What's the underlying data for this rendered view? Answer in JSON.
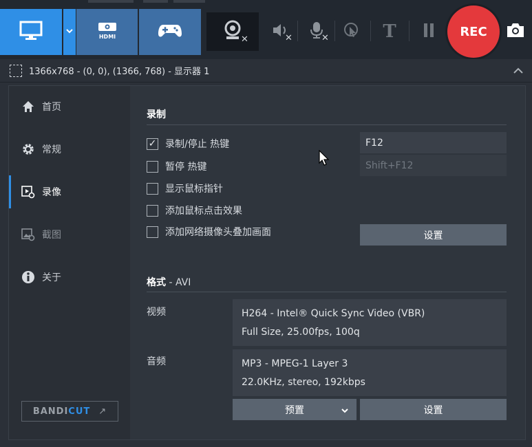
{
  "toolbar": {
    "modes": [
      {
        "name": "screen",
        "icon": "monitor-icon",
        "active": true
      },
      {
        "name": "hdmi",
        "icon": "hdmi-icon",
        "label": "HDMI"
      },
      {
        "name": "game",
        "icon": "gamepad-icon"
      }
    ],
    "tools": [
      {
        "name": "webcam",
        "icon": "webcam-icon"
      },
      {
        "name": "speaker",
        "icon": "speaker-icon"
      },
      {
        "name": "microphone",
        "icon": "microphone-icon"
      },
      {
        "name": "mouse-click",
        "icon": "click-icon"
      },
      {
        "name": "text",
        "icon": "text-icon",
        "label": "T"
      },
      {
        "name": "pause",
        "icon": "pause-icon"
      }
    ],
    "rec_label": "REC",
    "camera": "camera-icon",
    "accent_color": "#2f8fe6",
    "rec_color": "#e4393c"
  },
  "target": {
    "text": "1366x768 - (0, 0), (1366, 768) - 显示器 1"
  },
  "sidebar": {
    "items": [
      {
        "label": "首页",
        "icon": "home-icon"
      },
      {
        "label": "常规",
        "icon": "gear-icon"
      },
      {
        "label": "录像",
        "icon": "video-settings-icon",
        "active": true
      },
      {
        "label": "截图",
        "icon": "image-settings-icon"
      },
      {
        "label": "关于",
        "icon": "info-icon"
      }
    ],
    "brand_left": "BANDI",
    "brand_right": "CUT",
    "brand_arrow": "↗"
  },
  "recording": {
    "title": "录制",
    "options": [
      {
        "label": "录制/停止 热键",
        "checked": true
      },
      {
        "label": "暂停 热键",
        "checked": false
      },
      {
        "label": "显示鼠标指针",
        "checked": false
      },
      {
        "label": "添加鼠标点击效果",
        "checked": false
      },
      {
        "label": "添加网络摄像头叠加画面",
        "checked": false
      }
    ],
    "hotkey_record": "F12",
    "hotkey_pause": "Shift+F12",
    "webcam_settings_label": "设置"
  },
  "format": {
    "title": "格式",
    "subtitle": " - AVI",
    "video_label": "视频",
    "video_line1": "H264 - Intel® Quick Sync Video (VBR)",
    "video_line2": "Full Size, 25.00fps, 100q",
    "audio_label": "音频",
    "audio_line1": "MP3 - MPEG-1 Layer 3",
    "audio_line2": "22.0KHz, stereo, 192kbps",
    "preset_label": "预置",
    "settings_label": "设置"
  }
}
